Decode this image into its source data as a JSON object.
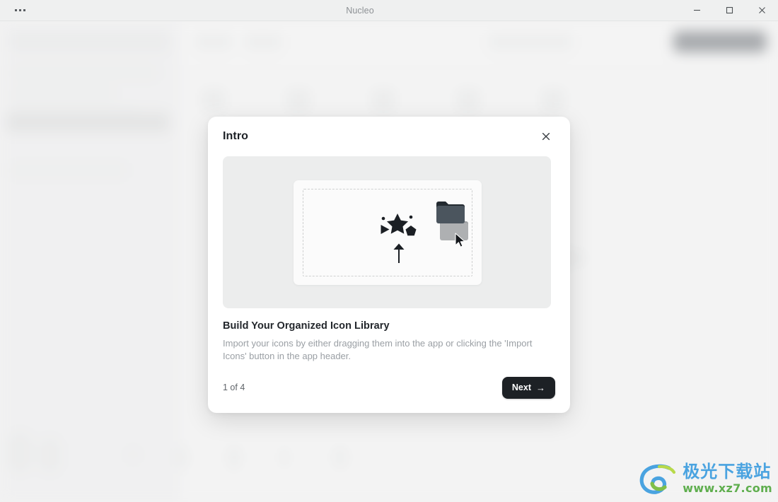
{
  "window": {
    "title": "Nucleo",
    "menu_icon": "kebab-menu-icon",
    "minimize_label": "minimize-icon",
    "maximize_label": "maximize-icon",
    "close_label": "close-icon"
  },
  "modal": {
    "title": "Intro",
    "close_icon": "close-icon",
    "illustration": {
      "alt": "drag-and-drop icons into app illustration",
      "glyph_shapes": [
        "dot",
        "star",
        "dot",
        "triangle",
        "pentagon"
      ],
      "arrow_icon": "arrow-up-icon",
      "drag_folder_icon": "folder-icon",
      "cursor_icon": "cursor-arrow-icon",
      "target_folder_icon": "folder-icon",
      "drag_folder_color": "#a9abad",
      "target_folder_body_color": "#4b555e",
      "target_folder_tab_color": "#232a31",
      "panel_color": "#eceded",
      "card_color": "#fbfbfb",
      "dash_color": "#cfd0d0"
    },
    "heading": "Build Your Organized Icon Library",
    "body": "Import your icons by either dragging them into the app or clicking the 'Import Icons' button in the app header.",
    "footer": {
      "page_indicator": "1 of 4",
      "current_page": 1,
      "total_pages": 4,
      "next_label": "Next",
      "next_arrow": "→",
      "next_bg_color": "#1d2125"
    }
  },
  "watermark": {
    "logo_icon": "swirl-logo-icon",
    "site_name": "极光下载站",
    "url": "www.xz7.com",
    "name_color": "#4aa3e0",
    "url_color": "#5fae4e"
  }
}
